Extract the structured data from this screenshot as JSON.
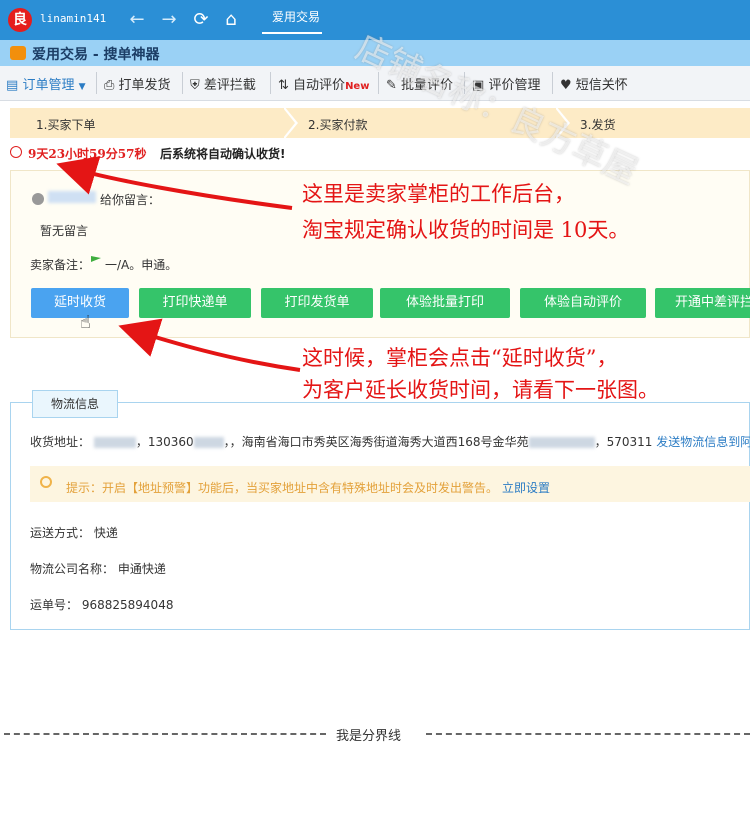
{
  "browser": {
    "logo_char": "良",
    "username": "linamin141",
    "back_icon": "←",
    "forward_icon": "→",
    "refresh_icon": "⟳",
    "home_icon": "⌂",
    "tab": "爱用交易"
  },
  "app": {
    "title": "爱用交易 - 搜单神器"
  },
  "menu": {
    "items": [
      {
        "label": "订单管理",
        "icon": "clipboard-icon",
        "dropdown": true
      },
      {
        "label": "打单发货",
        "icon": "printer-icon"
      },
      {
        "label": "差评拦截",
        "icon": "shield-icon"
      },
      {
        "label": "自动评价",
        "icon": "refresh-icon",
        "badge": "New"
      },
      {
        "label": "批量评价",
        "icon": "list-edit-icon"
      },
      {
        "label": "评价管理",
        "icon": "manage-icon"
      },
      {
        "label": "短信关怀",
        "icon": "heart-icon"
      }
    ]
  },
  "steps": [
    "1.买家下单",
    "2.买家付款",
    "3.发货"
  ],
  "countdown": {
    "time": "9天23小时59分57秒",
    "suffix": "后系统将自动确认收货!"
  },
  "order": {
    "message_label": "给你留言：",
    "message_value": "暂无留言",
    "seller_note_label": "卖家备注：",
    "seller_note_value": "一/A。申通。"
  },
  "actions": [
    "延时收货",
    "打印快递单",
    "打印发货单",
    "体验批量打印",
    "体验自动评价",
    "开通中差评拦"
  ],
  "logistics": {
    "tab": "物流信息",
    "address_label": "收货地址：",
    "phone_prefix": "，130360",
    "address_tail": "，，海南省海口市秀英区海秀街道海秀大道西168号金华苑",
    "postcode": "，570311",
    "send_link": "发送物流信息到阿",
    "tip": "提示：开启【地址预警】功能后，当买家地址中含有特殊地址时会及时发出警告。",
    "tip_link": "立即设置",
    "shipping_label": "运送方式：",
    "shipping_value": "快递",
    "company_label": "物流公司名称：",
    "company_value": "申通快递",
    "tracking_label": "运单号：",
    "tracking_value": "968825894048"
  },
  "divider": "我是分界线",
  "annotations": {
    "line1": "这里是卖家掌柜的工作后台，",
    "line2": "淘宝规定确认收货的时间是 10天。",
    "line3": "这时候，掌柜会点击“延时收货”，",
    "line4": "为客户延长收货时间，请看下一张图。"
  },
  "watermark": "店铺名称：良方草屋",
  "colors": {
    "browser_bar": "#2b8fd6",
    "title_bar": "#9ad1f5",
    "steps_bg": "#fdebc6",
    "countdown": "#e02020",
    "primary_button": "#4aa3f0",
    "green_button": "#35c46a",
    "annotation": "#e41515",
    "link": "#2b7cc4"
  }
}
